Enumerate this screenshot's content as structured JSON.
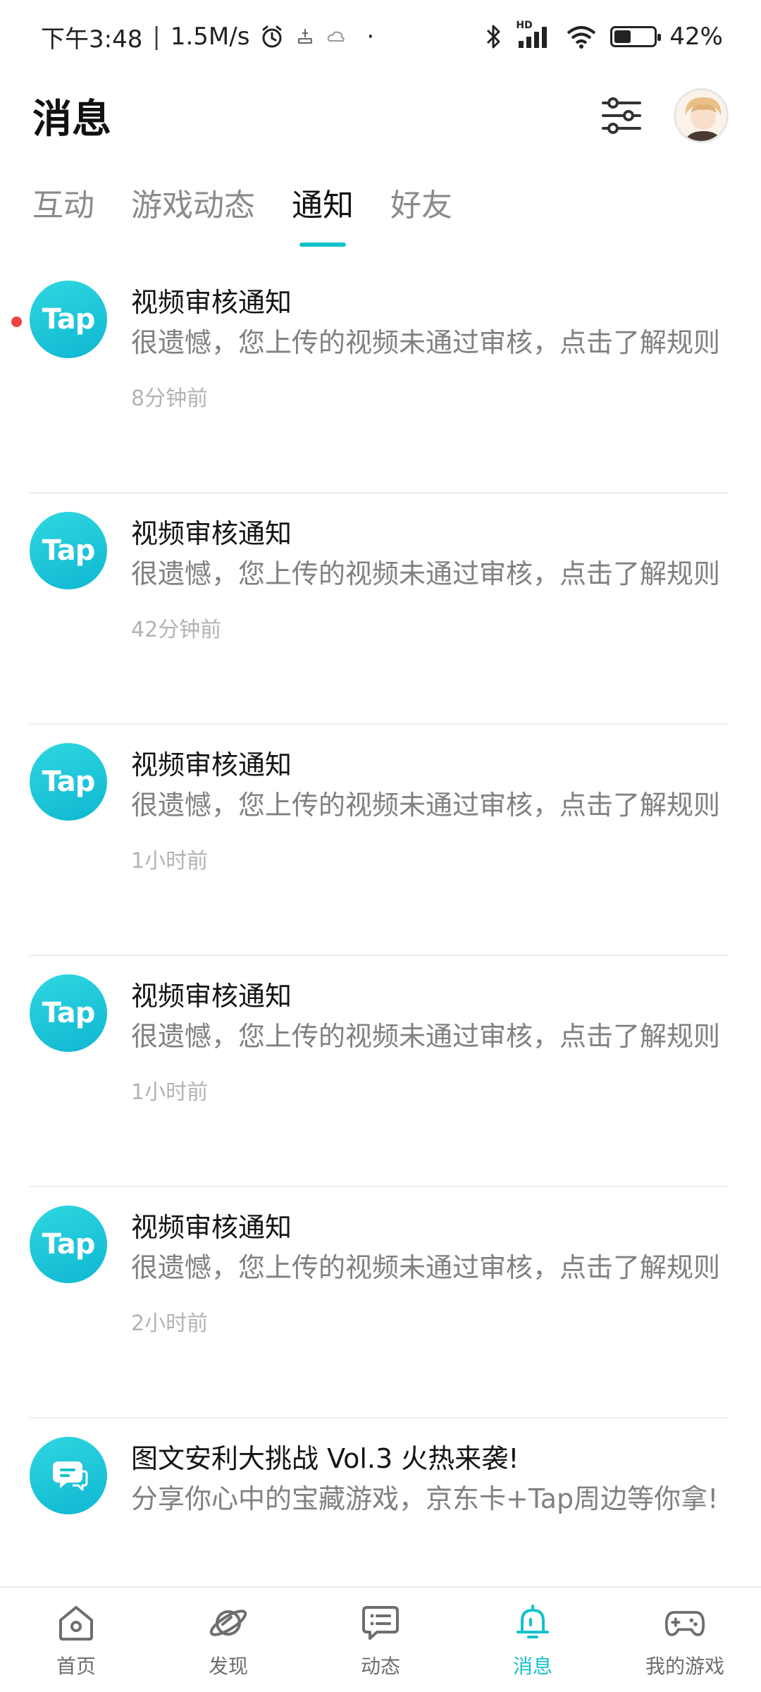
{
  "status_bar": {
    "time": "下午3:48",
    "speed": "1.5M/s",
    "dot": "·",
    "hd_label": "HD",
    "battery_percent": 42,
    "battery_text": "42%"
  },
  "header": {
    "title": "消息"
  },
  "tabs": [
    {
      "label": "互动",
      "active": false
    },
    {
      "label": "游戏动态",
      "active": false
    },
    {
      "label": "通知",
      "active": true
    },
    {
      "label": "好友",
      "active": false
    }
  ],
  "notifications": [
    {
      "icon": "tap-logo-icon",
      "icon_text": "Tap",
      "title": "视频审核通知",
      "text": "很遗憾，您上传的视频未通过审核，点击了解规则",
      "time": "8分钟前",
      "unread": true
    },
    {
      "icon": "tap-logo-icon",
      "icon_text": "Tap",
      "title": "视频审核通知",
      "text": "很遗憾，您上传的视频未通过审核，点击了解规则",
      "time": "42分钟前",
      "unread": false
    },
    {
      "icon": "tap-logo-icon",
      "icon_text": "Tap",
      "title": "视频审核通知",
      "text": "很遗憾，您上传的视频未通过审核，点击了解规则",
      "time": "1小时前",
      "unread": false
    },
    {
      "icon": "tap-logo-icon",
      "icon_text": "Tap",
      "title": "视频审核通知",
      "text": "很遗憾，您上传的视频未通过审核，点击了解规则",
      "time": "1小时前",
      "unread": false
    },
    {
      "icon": "tap-logo-icon",
      "icon_text": "Tap",
      "title": "视频审核通知",
      "text": "很遗憾，您上传的视频未通过审核，点击了解规则",
      "time": "2小时前",
      "unread": false
    },
    {
      "icon": "chat-bubble-icon",
      "icon_text": "",
      "title": "图文安利大挑战 Vol.3 火热来袭!",
      "text": "分享你心中的宝藏游戏，京东卡+Tap周边等你拿!",
      "time": "",
      "unread": false
    }
  ],
  "bottom_nav": [
    {
      "label": "首页",
      "icon": "home-icon",
      "active": false
    },
    {
      "label": "发现",
      "icon": "planet-icon",
      "active": false
    },
    {
      "label": "动态",
      "icon": "message-square-icon",
      "active": false
    },
    {
      "label": "消息",
      "icon": "bell-icon",
      "active": true
    },
    {
      "label": "我的游戏",
      "icon": "gamepad-icon",
      "active": false
    }
  ],
  "colors": {
    "accent": "#14c2cc",
    "unread_dot": "#f04040",
    "tap_icon": "#14c2cc"
  }
}
